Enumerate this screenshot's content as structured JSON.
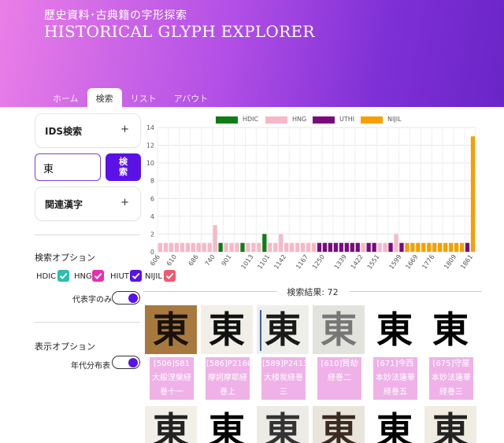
{
  "header": {
    "subtitle": "歴史資料･古典籍の字形探索",
    "title": "HISTORICAL GLYPH EXPLORER"
  },
  "tabs": [
    {
      "label": "ホーム",
      "active": false
    },
    {
      "label": "検索",
      "active": true
    },
    {
      "label": "リスト",
      "active": false
    },
    {
      "label": "アバウト",
      "active": false
    }
  ],
  "sidebar": {
    "ids_search_label": "IDS検索",
    "plus": "+",
    "search_value": "東",
    "search_button": "検索",
    "related_label": "関連漢字",
    "search_options_title": "検索オプション",
    "checks": [
      {
        "label": "HDIC",
        "checked": true,
        "color": "#2bbfae"
      },
      {
        "label": "HNG",
        "checked": true,
        "color": "#e62fb0"
      },
      {
        "label": "HIUT",
        "checked": true,
        "color": "#5a12e6"
      },
      {
        "label": "NIJIL",
        "checked": true,
        "color": "#ef5a6e"
      }
    ],
    "representative_label": "代表字のみ",
    "representative_on": true,
    "display_options_title": "表示オプション",
    "timeline_label": "年代分布表",
    "timeline_on": true
  },
  "chart_data": {
    "type": "bar",
    "legend": [
      {
        "name": "HDIC",
        "color": "#0e7d14"
      },
      {
        "name": "HNG",
        "color": "#f7b8c8"
      },
      {
        "name": "UTHI",
        "color": "#7a0a7e"
      },
      {
        "name": "NIJIL",
        "color": "#f5a000"
      }
    ],
    "ylim": [
      0,
      14
    ],
    "yticks": [
      0,
      2,
      4,
      6,
      8,
      10,
      12,
      14
    ],
    "xtick_labels": [
      "606",
      "610",
      "686",
      "740",
      "901",
      "1013",
      "1101",
      "1142",
      "1167",
      "1250",
      "1339",
      "1422",
      "1551",
      "1599",
      "1669",
      "1776",
      "1809",
      "1861"
    ],
    "bars": [
      {
        "series": "HNG",
        "value": 1
      },
      {
        "series": "HNG",
        "value": 1
      },
      {
        "series": "HNG",
        "value": 1
      },
      {
        "series": "HNG",
        "value": 1
      },
      {
        "series": "HNG",
        "value": 1
      },
      {
        "series": "HNG",
        "value": 1
      },
      {
        "series": "HNG",
        "value": 1
      },
      {
        "series": "HNG",
        "value": 1
      },
      {
        "series": "HNG",
        "value": 1
      },
      {
        "series": "HNG",
        "value": 1
      },
      {
        "series": "HNG",
        "value": 3
      },
      {
        "series": "HDIC",
        "value": 1
      },
      {
        "series": "HNG",
        "value": 1
      },
      {
        "series": "HNG",
        "value": 1
      },
      {
        "series": "HNG",
        "value": 1
      },
      {
        "series": "HDIC",
        "value": 1
      },
      {
        "series": "HNG",
        "value": 1
      },
      {
        "series": "HNG",
        "value": 1
      },
      {
        "series": "HNG",
        "value": 1
      },
      {
        "series": "HDIC",
        "value": 2
      },
      {
        "series": "HNG",
        "value": 1
      },
      {
        "series": "HNG",
        "value": 1
      },
      {
        "series": "HNG",
        "value": 2
      },
      {
        "series": "HNG",
        "value": 1
      },
      {
        "series": "HNG",
        "value": 1
      },
      {
        "series": "HNG",
        "value": 1
      },
      {
        "series": "HNG",
        "value": 1
      },
      {
        "series": "HNG",
        "value": 1
      },
      {
        "series": "HNG",
        "value": 1
      },
      {
        "series": "UTHI",
        "value": 1
      },
      {
        "series": "UTHI",
        "value": 1
      },
      {
        "series": "UTHI",
        "value": 1
      },
      {
        "series": "UTHI",
        "value": 1
      },
      {
        "series": "UTHI",
        "value": 1
      },
      {
        "series": "UTHI",
        "value": 1
      },
      {
        "series": "UTHI",
        "value": 1
      },
      {
        "series": "UTHI",
        "value": 1
      },
      {
        "series": "HNG",
        "value": 1
      },
      {
        "series": "UTHI",
        "value": 1
      },
      {
        "series": "UTHI",
        "value": 1
      },
      {
        "series": "HNG",
        "value": 1
      },
      {
        "series": "HNG",
        "value": 1
      },
      {
        "series": "UTHI",
        "value": 1
      },
      {
        "series": "HNG",
        "value": 2
      },
      {
        "series": "UTHI",
        "value": 1
      },
      {
        "series": "NIJIL",
        "value": 1
      },
      {
        "series": "NIJIL",
        "value": 1
      },
      {
        "series": "NIJIL",
        "value": 1
      },
      {
        "series": "NIJIL",
        "value": 1
      },
      {
        "series": "NIJIL",
        "value": 1
      },
      {
        "series": "NIJIL",
        "value": 1
      },
      {
        "series": "NIJIL",
        "value": 1
      },
      {
        "series": "NIJIL",
        "value": 1
      },
      {
        "series": "NIJIL",
        "value": 1
      },
      {
        "series": "NIJIL",
        "value": 1
      },
      {
        "series": "NIJIL",
        "value": 1
      },
      {
        "series": "UTHI",
        "value": 1
      },
      {
        "series": "NIJIL",
        "value": 13
      }
    ]
  },
  "results": {
    "count_text": "検索結果: 72",
    "items": [
      {
        "glyph": "東",
        "caption": "[506]S81大般涅槃経巻十一",
        "bg": "#a8793f",
        "ink": "#1a120a"
      },
      {
        "glyph": "東",
        "caption": "[586]P2160摩訶摩耶経巻上",
        "bg": "#f1efe8",
        "ink": "#111111"
      },
      {
        "glyph": "東",
        "caption": "[589]P2413大楼炭経巻三",
        "bg": "#eeeeea",
        "ink": "#1a1a1a"
      },
      {
        "glyph": "東",
        "caption": "[610]賢劫経巻二",
        "bg": "#e3e3dd",
        "ink": "#777777"
      },
      {
        "glyph": "東",
        "caption": "[671]今西本妙法蓮華経巻五",
        "bg": "#ffffff",
        "ink": "#000000"
      },
      {
        "glyph": "東",
        "caption": "[675]守屋本妙法蓮華経巻三",
        "bg": "#ffffff",
        "ink": "#000000"
      }
    ],
    "row2": [
      {
        "glyph": "東",
        "bg": "#f2efe8",
        "ink": "#222222"
      },
      {
        "glyph": "東",
        "bg": "#ffffff",
        "ink": "#000000"
      },
      {
        "glyph": "東",
        "bg": "#ecebe6",
        "ink": "#333333"
      },
      {
        "glyph": "東",
        "bg": "#e9e4dc",
        "ink": "#3a2a20"
      },
      {
        "glyph": "東",
        "bg": "#ffffff",
        "ink": "#000000"
      },
      {
        "glyph": "東",
        "bg": "#f0ece2",
        "ink": "#222222"
      }
    ]
  }
}
